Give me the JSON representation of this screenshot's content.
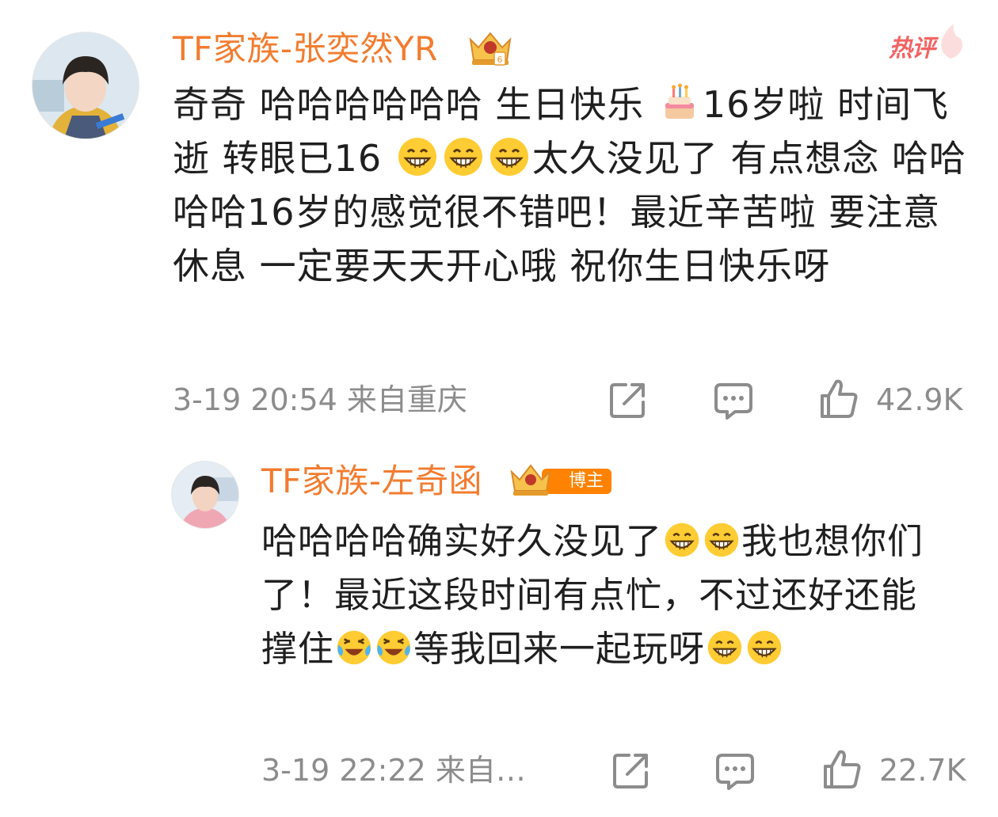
{
  "comment": {
    "author": "TF家族-张奕然YR",
    "hot_label": "热评",
    "text_parts": [
      "奇奇 哈哈哈哈哈哈 生日快乐 ",
      "16岁啦 时间飞逝 转眼已16 ",
      "太久没见了 有点想念 哈哈哈哈16岁的感觉很不错吧！最近辛苦啦 要注意休息 一定要天天开心哦 祝你生日快乐呀"
    ],
    "time_location": "3-19 20:54  来自重庆",
    "likes": "42.9K"
  },
  "reply": {
    "author": "TF家族-左奇函",
    "badge_label": "博主",
    "text_parts": [
      "哈哈哈哈确实好久没见了",
      "我也想你们了！最近这段时间有点忙，不过还好还能撑住",
      "等我回来一起玩呀"
    ],
    "time_location": "3-19 22:22  来自…",
    "likes": "22.7K"
  },
  "colors": {
    "name": "#f27c2f",
    "meta": "#8c8c8c",
    "hot": "#f26464",
    "badge": "#ff8200"
  },
  "icons": [
    "birthday-cake-icon",
    "grin-emoji",
    "laugh-cry-emoji",
    "share-icon",
    "comment-icon",
    "like-icon",
    "crown-badge-icon"
  ]
}
